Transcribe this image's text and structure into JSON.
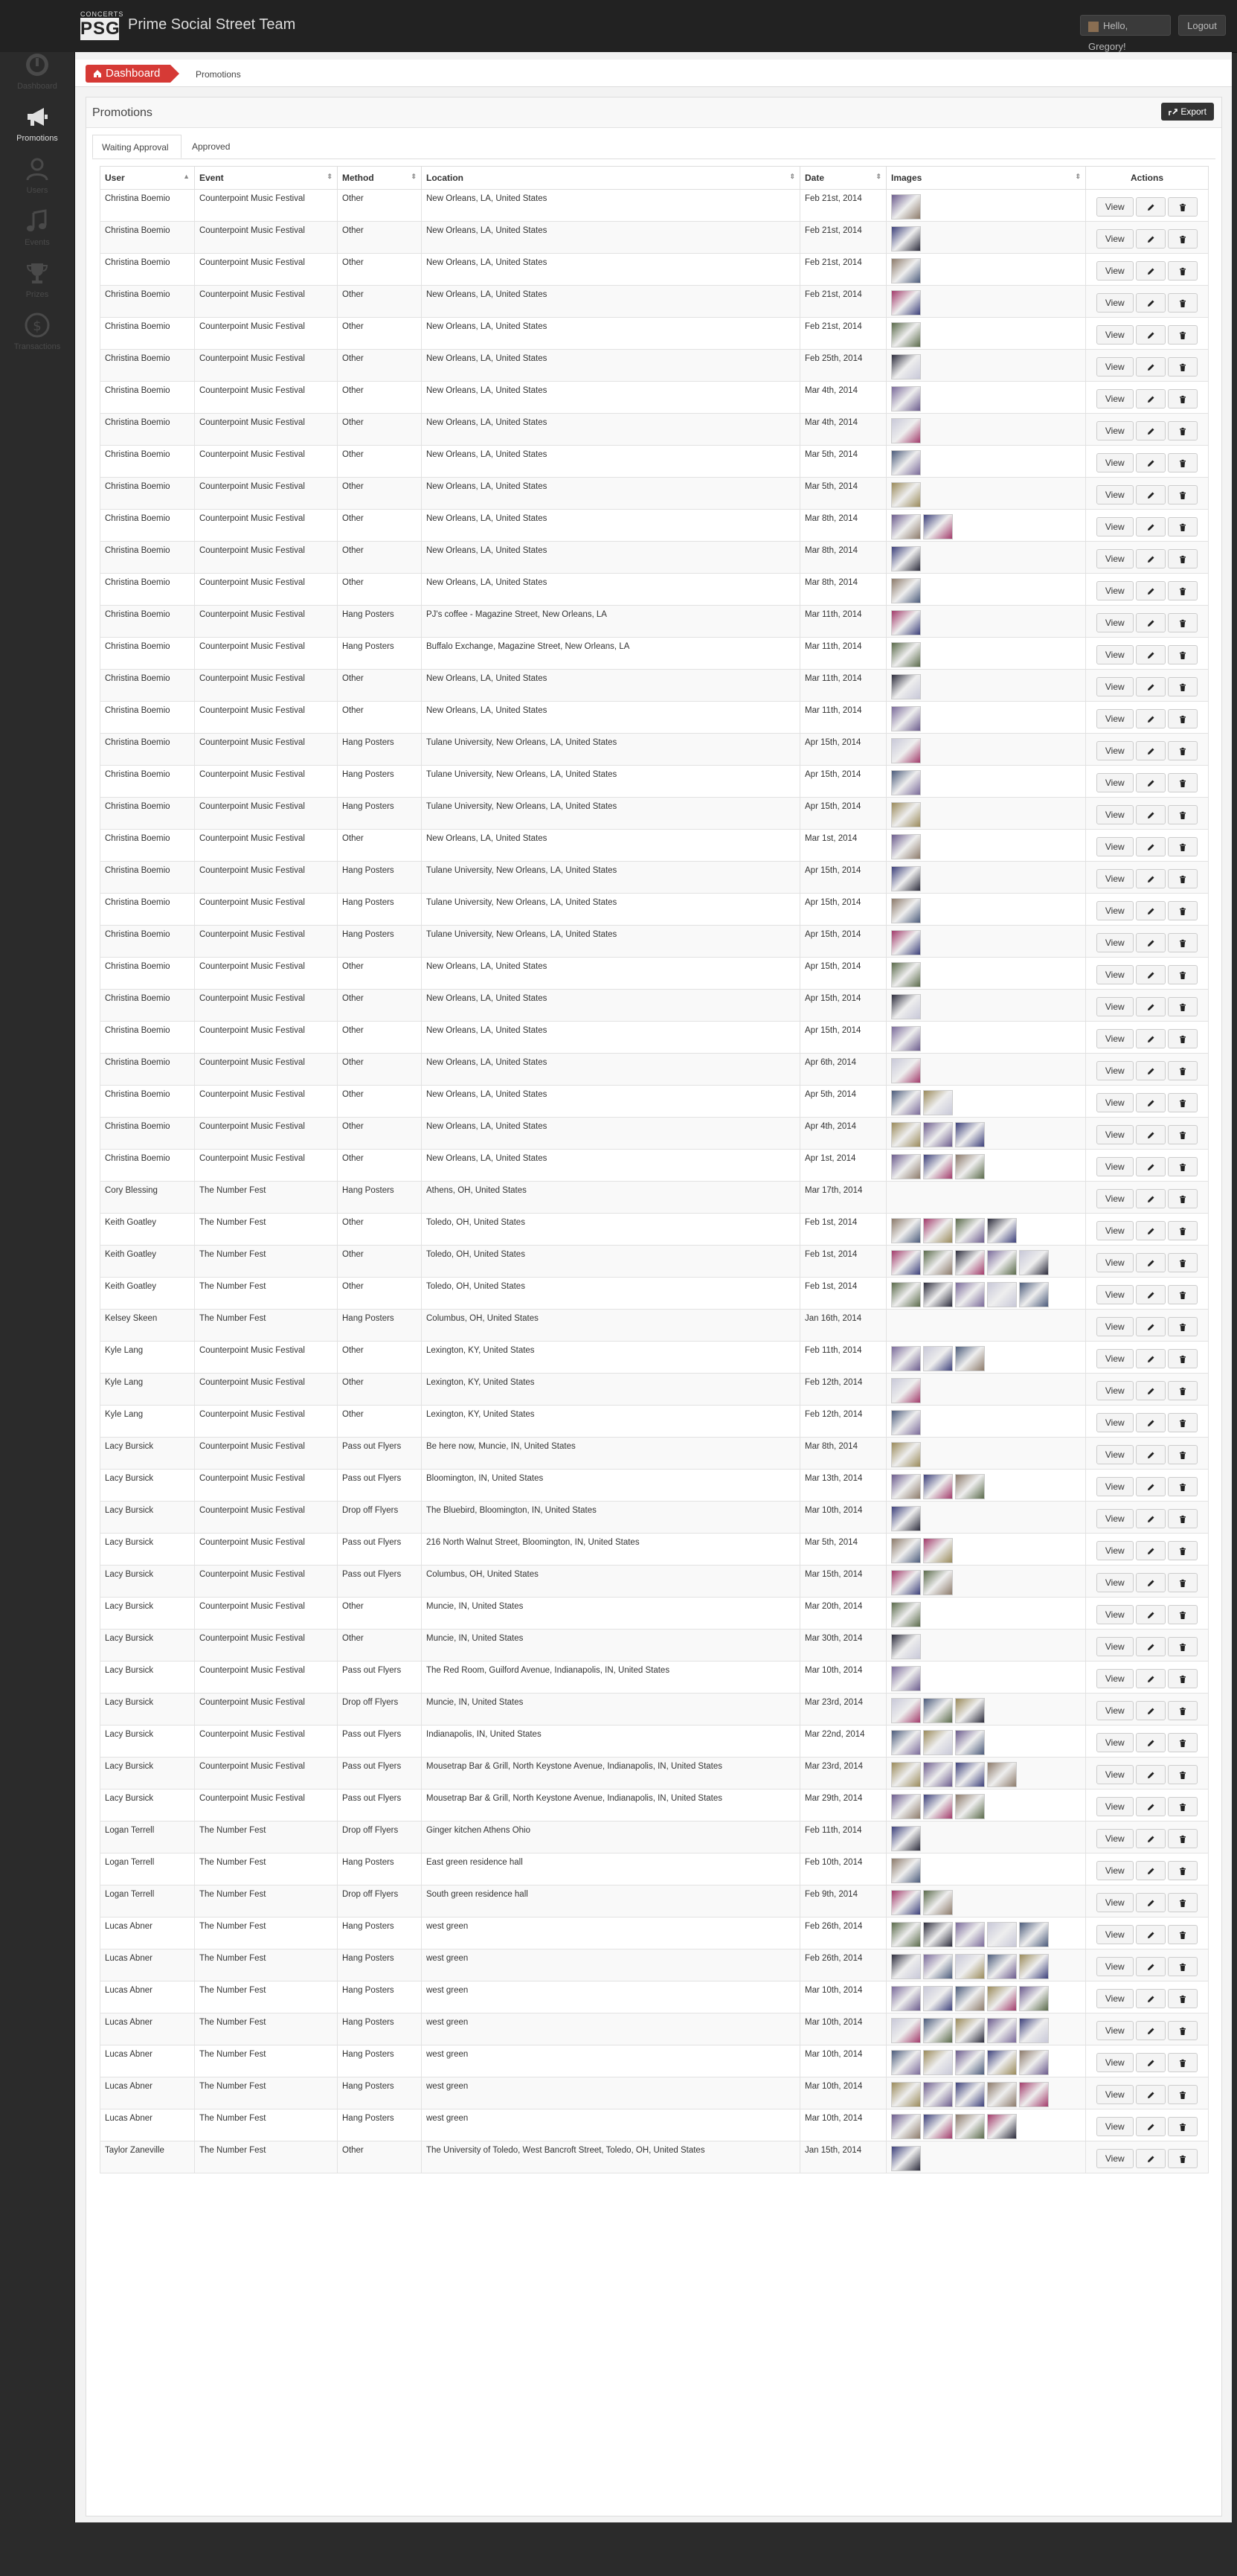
{
  "header": {
    "logo_small": "CONCERTS",
    "logo_big": "PSG",
    "title": "Prime Social Street Team",
    "user_label": "Hello, Gregory!",
    "logout_label": "Logout"
  },
  "sidebar": {
    "items": [
      {
        "label": "Dashboard",
        "icon": "dashboard-icon",
        "active": false
      },
      {
        "label": "Promotions",
        "icon": "megaphone-icon",
        "active": true
      },
      {
        "label": "Users",
        "icon": "users-icon",
        "active": false
      },
      {
        "label": "Events",
        "icon": "music-note-icon",
        "active": false
      },
      {
        "label": "Prizes",
        "icon": "trophy-icon",
        "active": false
      },
      {
        "label": "Transactions",
        "icon": "dollar-icon",
        "active": false
      }
    ]
  },
  "breadcrumb": {
    "home": "Dashboard",
    "current": "Promotions"
  },
  "panel": {
    "title": "Promotions",
    "export_label": "Export"
  },
  "tabs": [
    "Waiting Approval",
    "Approved"
  ],
  "table": {
    "columns": [
      "User",
      "Event",
      "Method",
      "Location",
      "Date",
      "Images",
      "Actions"
    ],
    "view_label": "View",
    "rows": [
      [
        "Christina Boemio",
        "Counterpoint Music Festival",
        "Other",
        "New Orleans, LA, United States",
        "Feb 21st, 2014",
        1
      ],
      [
        "Christina Boemio",
        "Counterpoint Music Festival",
        "Other",
        "New Orleans, LA, United States",
        "Feb 21st, 2014",
        1
      ],
      [
        "Christina Boemio",
        "Counterpoint Music Festival",
        "Other",
        "New Orleans, LA, United States",
        "Feb 21st, 2014",
        1
      ],
      [
        "Christina Boemio",
        "Counterpoint Music Festival",
        "Other",
        "New Orleans, LA, United States",
        "Feb 21st, 2014",
        1
      ],
      [
        "Christina Boemio",
        "Counterpoint Music Festival",
        "Other",
        "New Orleans, LA, United States",
        "Feb 21st, 2014",
        1
      ],
      [
        "Christina Boemio",
        "Counterpoint Music Festival",
        "Other",
        "New Orleans, LA, United States",
        "Feb 25th, 2014",
        1
      ],
      [
        "Christina Boemio",
        "Counterpoint Music Festival",
        "Other",
        "New Orleans, LA, United States",
        "Mar 4th, 2014",
        1
      ],
      [
        "Christina Boemio",
        "Counterpoint Music Festival",
        "Other",
        "New Orleans, LA, United States",
        "Mar 4th, 2014",
        1
      ],
      [
        "Christina Boemio",
        "Counterpoint Music Festival",
        "Other",
        "New Orleans, LA, United States",
        "Mar 5th, 2014",
        1
      ],
      [
        "Christina Boemio",
        "Counterpoint Music Festival",
        "Other",
        "New Orleans, LA, United States",
        "Mar 5th, 2014",
        1
      ],
      [
        "Christina Boemio",
        "Counterpoint Music Festival",
        "Other",
        "New Orleans, LA, United States",
        "Mar 8th, 2014",
        2
      ],
      [
        "Christina Boemio",
        "Counterpoint Music Festival",
        "Other",
        "New Orleans, LA, United States",
        "Mar 8th, 2014",
        1
      ],
      [
        "Christina Boemio",
        "Counterpoint Music Festival",
        "Other",
        "New Orleans, LA, United States",
        "Mar 8th, 2014",
        1
      ],
      [
        "Christina Boemio",
        "Counterpoint Music Festival",
        "Hang Posters",
        "PJ's coffee - Magazine Street, New Orleans, LA",
        "Mar 11th, 2014",
        1
      ],
      [
        "Christina Boemio",
        "Counterpoint Music Festival",
        "Hang Posters",
        "Buffalo Exchange, Magazine Street, New Orleans, LA",
        "Mar 11th, 2014",
        1
      ],
      [
        "Christina Boemio",
        "Counterpoint Music Festival",
        "Other",
        "New Orleans, LA, United States",
        "Mar 11th, 2014",
        1
      ],
      [
        "Christina Boemio",
        "Counterpoint Music Festival",
        "Other",
        "New Orleans, LA, United States",
        "Mar 11th, 2014",
        1
      ],
      [
        "Christina Boemio",
        "Counterpoint Music Festival",
        "Hang Posters",
        "Tulane University, New Orleans, LA, United States",
        "Apr 15th, 2014",
        1
      ],
      [
        "Christina Boemio",
        "Counterpoint Music Festival",
        "Hang Posters",
        "Tulane University, New Orleans, LA, United States",
        "Apr 15th, 2014",
        1
      ],
      [
        "Christina Boemio",
        "Counterpoint Music Festival",
        "Hang Posters",
        "Tulane University, New Orleans, LA, United States",
        "Apr 15th, 2014",
        1
      ],
      [
        "Christina Boemio",
        "Counterpoint Music Festival",
        "Other",
        "New Orleans, LA, United States",
        "Mar 1st, 2014",
        1
      ],
      [
        "Christina Boemio",
        "Counterpoint Music Festival",
        "Hang Posters",
        "Tulane University, New Orleans, LA, United States",
        "Apr 15th, 2014",
        1
      ],
      [
        "Christina Boemio",
        "Counterpoint Music Festival",
        "Hang Posters",
        "Tulane University, New Orleans, LA, United States",
        "Apr 15th, 2014",
        1
      ],
      [
        "Christina Boemio",
        "Counterpoint Music Festival",
        "Hang Posters",
        "Tulane University, New Orleans, LA, United States",
        "Apr 15th, 2014",
        1
      ],
      [
        "Christina Boemio",
        "Counterpoint Music Festival",
        "Other",
        "New Orleans, LA, United States",
        "Apr 15th, 2014",
        1
      ],
      [
        "Christina Boemio",
        "Counterpoint Music Festival",
        "Other",
        "New Orleans, LA, United States",
        "Apr 15th, 2014",
        1
      ],
      [
        "Christina Boemio",
        "Counterpoint Music Festival",
        "Other",
        "New Orleans, LA, United States",
        "Apr 15th, 2014",
        1
      ],
      [
        "Christina Boemio",
        "Counterpoint Music Festival",
        "Other",
        "New Orleans, LA, United States",
        "Apr 6th, 2014",
        1
      ],
      [
        "Christina Boemio",
        "Counterpoint Music Festival",
        "Other",
        "New Orleans, LA, United States",
        "Apr 5th, 2014",
        2
      ],
      [
        "Christina Boemio",
        "Counterpoint Music Festival",
        "Other",
        "New Orleans, LA, United States",
        "Apr 4th, 2014",
        3
      ],
      [
        "Christina Boemio",
        "Counterpoint Music Festival",
        "Other",
        "New Orleans, LA, United States",
        "Apr 1st, 2014",
        3
      ],
      [
        "Cory Blessing",
        "The Number Fest",
        "Hang Posters",
        "Athens, OH, United States",
        "Mar 17th, 2014",
        0
      ],
      [
        "Keith Goatley",
        "The Number Fest",
        "Other",
        "Toledo, OH, United States",
        "Feb 1st, 2014",
        4
      ],
      [
        "Keith Goatley",
        "The Number Fest",
        "Other",
        "Toledo, OH, United States",
        "Feb 1st, 2014",
        5
      ],
      [
        "Keith Goatley",
        "The Number Fest",
        "Other",
        "Toledo, OH, United States",
        "Feb 1st, 2014",
        5
      ],
      [
        "Kelsey Skeen",
        "The Number Fest",
        "Hang Posters",
        "Columbus, OH, United States",
        "Jan 16th, 2014",
        0
      ],
      [
        "Kyle Lang",
        "Counterpoint Music Festival",
        "Other",
        "Lexington, KY, United States",
        "Feb 11th, 2014",
        3
      ],
      [
        "Kyle Lang",
        "Counterpoint Music Festival",
        "Other",
        "Lexington, KY, United States",
        "Feb 12th, 2014",
        1
      ],
      [
        "Kyle Lang",
        "Counterpoint Music Festival",
        "Other",
        "Lexington, KY, United States",
        "Feb 12th, 2014",
        1
      ],
      [
        "Lacy Bursick",
        "Counterpoint Music Festival",
        "Pass out Flyers",
        "Be here now, Muncie, IN, United States",
        "Mar 8th, 2014",
        1
      ],
      [
        "Lacy Bursick",
        "Counterpoint Music Festival",
        "Pass out Flyers",
        "Bloomington, IN, United States",
        "Mar 13th, 2014",
        3
      ],
      [
        "Lacy Bursick",
        "Counterpoint Music Festival",
        "Drop off Flyers",
        "The Bluebird, Bloomington, IN, United States",
        "Mar 10th, 2014",
        1
      ],
      [
        "Lacy Bursick",
        "Counterpoint Music Festival",
        "Pass out Flyers",
        "216 North Walnut Street, Bloomington, IN, United States",
        "Mar 5th, 2014",
        2
      ],
      [
        "Lacy Bursick",
        "Counterpoint Music Festival",
        "Pass out Flyers",
        "Columbus, OH, United States",
        "Mar 15th, 2014",
        2
      ],
      [
        "Lacy Bursick",
        "Counterpoint Music Festival",
        "Other",
        "Muncie, IN, United States",
        "Mar 20th, 2014",
        1
      ],
      [
        "Lacy Bursick",
        "Counterpoint Music Festival",
        "Other",
        "Muncie, IN, United States",
        "Mar 30th, 2014",
        1
      ],
      [
        "Lacy Bursick",
        "Counterpoint Music Festival",
        "Pass out Flyers",
        "The Red Room, Guilford Avenue, Indianapolis, IN, United States",
        "Mar 10th, 2014",
        1
      ],
      [
        "Lacy Bursick",
        "Counterpoint Music Festival",
        "Drop off Flyers",
        "Muncie, IN, United States",
        "Mar 23rd, 2014",
        3
      ],
      [
        "Lacy Bursick",
        "Counterpoint Music Festival",
        "Pass out Flyers",
        "Indianapolis, IN, United States",
        "Mar 22nd, 2014",
        3
      ],
      [
        "Lacy Bursick",
        "Counterpoint Music Festival",
        "Pass out Flyers",
        "Mousetrap Bar & Grill, North Keystone Avenue, Indianapolis, IN, United States",
        "Mar 23rd, 2014",
        4
      ],
      [
        "Lacy Bursick",
        "Counterpoint Music Festival",
        "Pass out Flyers",
        "Mousetrap Bar & Grill, North Keystone Avenue, Indianapolis, IN, United States",
        "Mar 29th, 2014",
        3
      ],
      [
        "Logan Terrell",
        "The Number Fest",
        "Drop off Flyers",
        "Ginger kitchen Athens Ohio",
        "Feb 11th, 2014",
        1
      ],
      [
        "Logan Terrell",
        "The Number Fest",
        "Hang Posters",
        "East green residence hall",
        "Feb 10th, 2014",
        1
      ],
      [
        "Logan Terrell",
        "The Number Fest",
        "Drop off Flyers",
        "South green residence hall",
        "Feb 9th, 2014",
        2
      ],
      [
        "Lucas Abner",
        "The Number Fest",
        "Hang Posters",
        "west green",
        "Feb 26th, 2014",
        5
      ],
      [
        "Lucas Abner",
        "The Number Fest",
        "Hang Posters",
        "west green",
        "Feb 26th, 2014",
        5
      ],
      [
        "Lucas Abner",
        "The Number Fest",
        "Hang Posters",
        "west green",
        "Mar 10th, 2014",
        5
      ],
      [
        "Lucas Abner",
        "The Number Fest",
        "Hang Posters",
        "west green",
        "Mar 10th, 2014",
        5
      ],
      [
        "Lucas Abner",
        "The Number Fest",
        "Hang Posters",
        "west green",
        "Mar 10th, 2014",
        5
      ],
      [
        "Lucas Abner",
        "The Number Fest",
        "Hang Posters",
        "west green",
        "Mar 10th, 2014",
        5
      ],
      [
        "Lucas Abner",
        "The Number Fest",
        "Hang Posters",
        "west green",
        "Mar 10th, 2014",
        4
      ],
      [
        "Taylor Zaneville",
        "The Number Fest",
        "Other",
        "The University of Toledo, West Bancroft Street, Toledo, OH, United States",
        "Jan 15th, 2014",
        1
      ]
    ]
  },
  "colors": {
    "accent": "#d63a36",
    "topbar": "#222222",
    "sidebar": "#2b2b2b"
  }
}
